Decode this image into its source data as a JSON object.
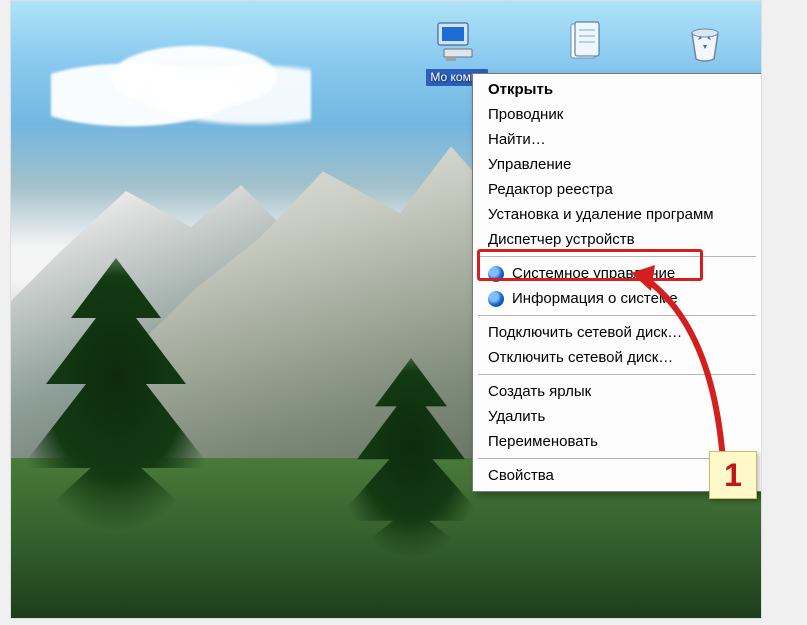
{
  "desktop": {
    "icons": {
      "my_computer_label": "Мо\nкомпь",
      "my_documents_label": "",
      "recycle_label": ""
    }
  },
  "context_menu": {
    "groups": [
      [
        {
          "label": "Открыть",
          "bold": true,
          "icon": null
        },
        {
          "label": "Проводник",
          "icon": null
        },
        {
          "label": "Найти…",
          "icon": null
        },
        {
          "label": "Управление",
          "icon": null
        },
        {
          "label": "Редактор реестра",
          "icon": null
        },
        {
          "label": "Установка и удаление программ",
          "icon": null
        },
        {
          "label": "Диспетчер устройств",
          "icon": null,
          "highlighted": true
        }
      ],
      [
        {
          "label": "Системное управление",
          "icon": "blue-circle"
        },
        {
          "label": "Информация о системе",
          "icon": "blue-circle"
        }
      ],
      [
        {
          "label": "Подключить сетевой диск…",
          "icon": null
        },
        {
          "label": "Отключить сетевой диск…",
          "icon": null
        }
      ],
      [
        {
          "label": "Создать ярлык",
          "icon": null
        },
        {
          "label": "Удалить",
          "icon": null
        },
        {
          "label": "Переименовать",
          "icon": null
        }
      ],
      [
        {
          "label": "Свойства",
          "icon": null
        }
      ]
    ]
  },
  "callout": {
    "number": "1"
  }
}
